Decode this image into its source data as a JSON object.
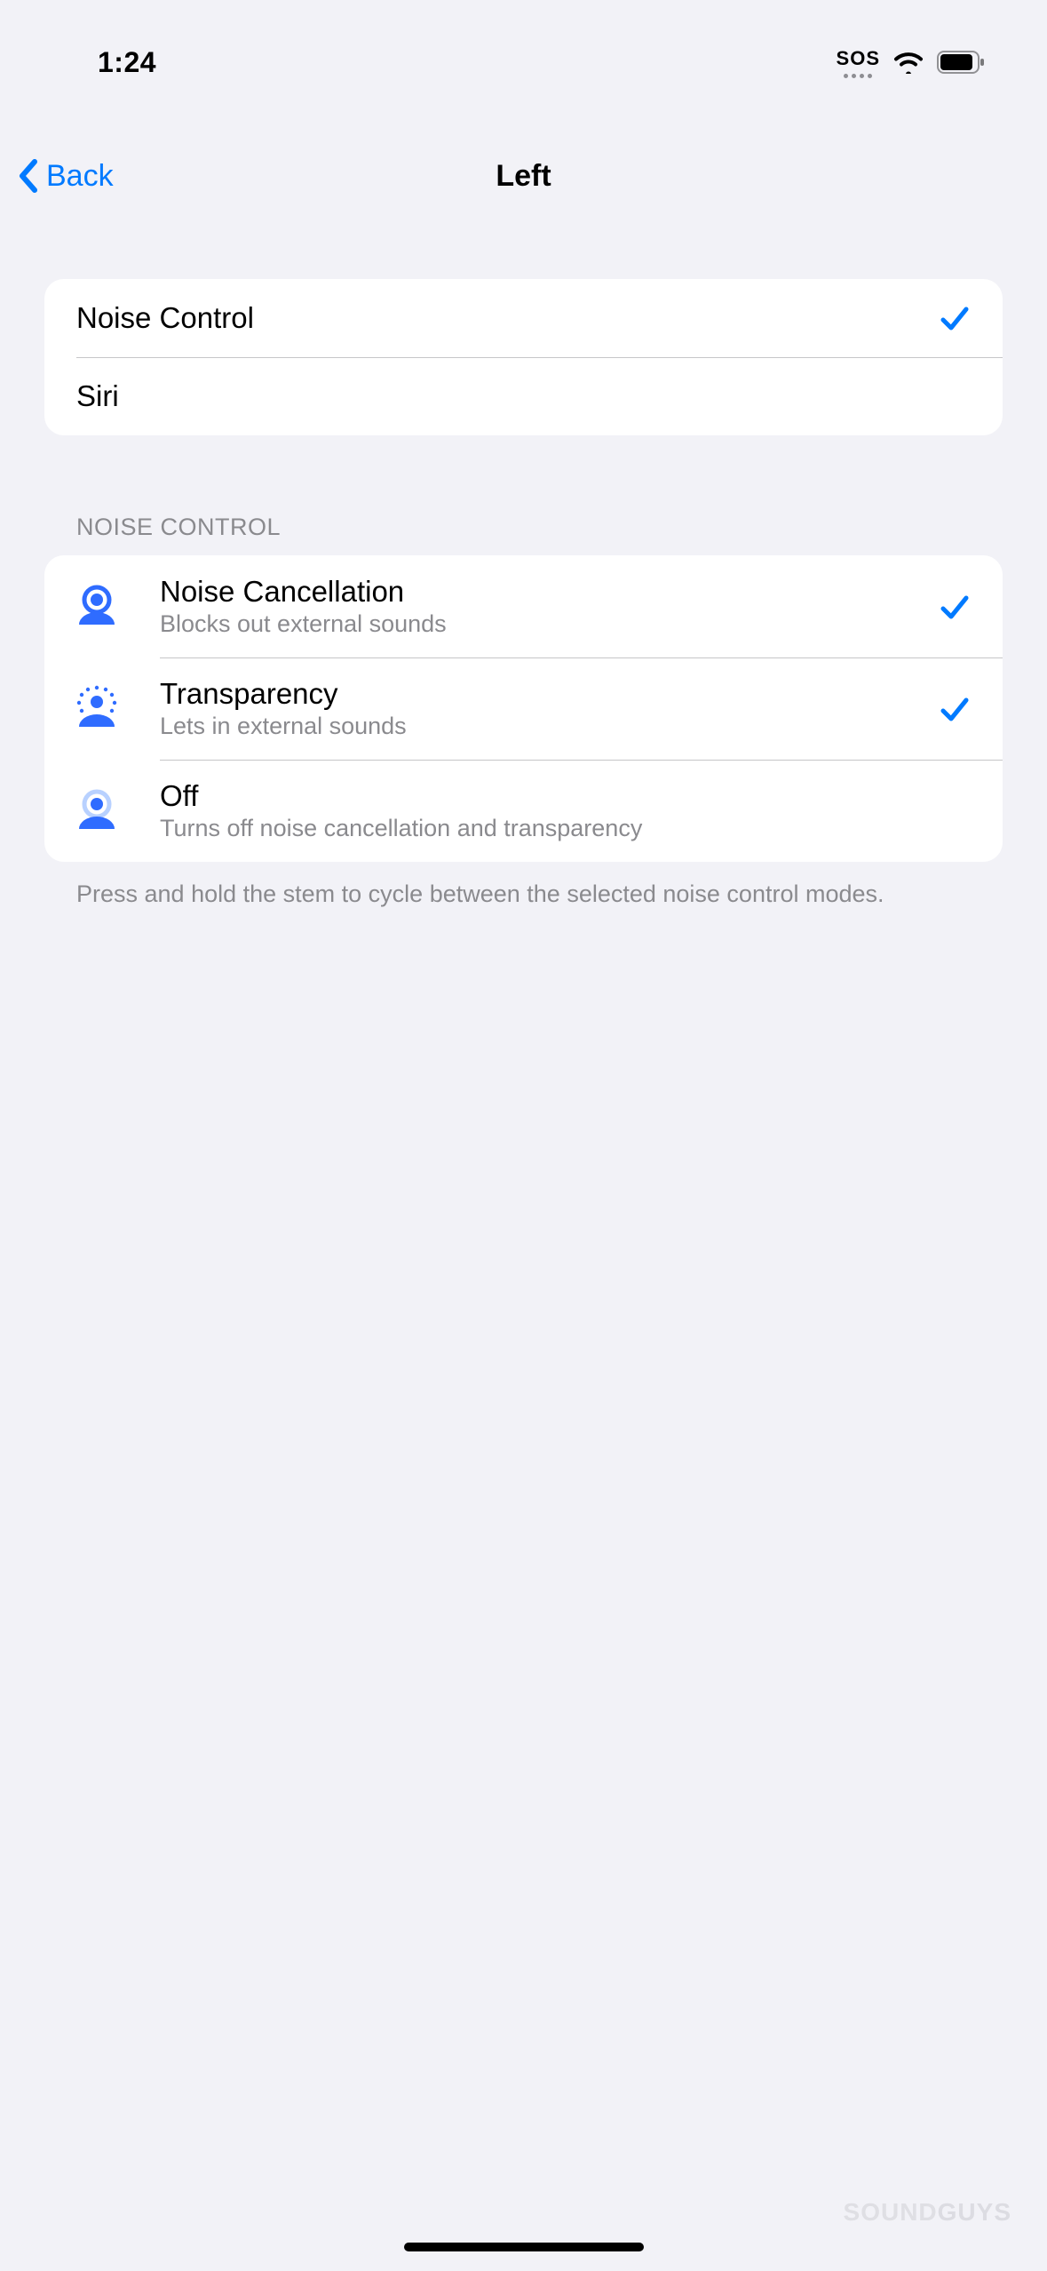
{
  "status": {
    "time": "1:24",
    "sos": "SOS"
  },
  "nav": {
    "back": "Back",
    "title": "Left"
  },
  "group1": {
    "items": [
      {
        "label": "Noise Control",
        "checked": true
      },
      {
        "label": "Siri",
        "checked": false
      }
    ]
  },
  "section2": {
    "header": "NOISE CONTROL",
    "items": [
      {
        "title": "Noise Cancellation",
        "subtitle": "Blocks out external sounds",
        "checked": true,
        "icon": "noise-cancellation-icon"
      },
      {
        "title": "Transparency",
        "subtitle": "Lets in external sounds",
        "checked": true,
        "icon": "transparency-icon"
      },
      {
        "title": "Off",
        "subtitle": "Turns off noise cancellation and transparency",
        "checked": false,
        "icon": "off-icon"
      }
    ],
    "footer": "Press and hold the stem to cycle between the selected noise control modes."
  },
  "watermark": {
    "a": "SOUND",
    "b": "GUYS"
  },
  "colors": {
    "accent": "#007aff",
    "bg": "#f2f2f7",
    "card": "#ffffff",
    "secondary": "#8a8a8e"
  }
}
